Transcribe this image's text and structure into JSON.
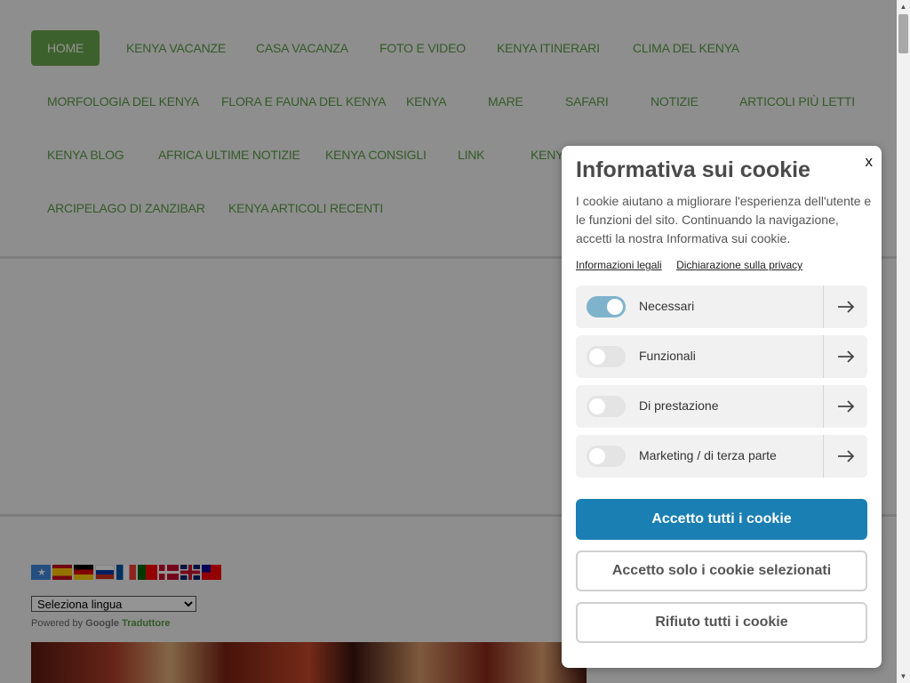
{
  "nav": {
    "items": [
      "HOME",
      "KENYA VACANZE",
      "CASA VACANZA",
      "FOTO E VIDEO",
      "KENYA ITINERARI",
      "CLIMA DEL KENYA",
      "MORFOLOGIA DEL KENYA",
      "FLORA E FAUNA DEL KENYA",
      "KENYA",
      "MARE",
      "SAFARI",
      "NOTIZIE",
      "ARTICOLI PIÙ LETTI",
      "KENYA BLOG",
      "AFRICA ULTIME NOTIZIE",
      "KENYA CONSIGLI",
      "LINK",
      "KENYA",
      "ARCIPELAGO DI ZANZIBAR",
      "KENYA ARTICOLI RECENTI"
    ]
  },
  "translate": {
    "select_label": "Seleziona lingua",
    "powered_by": "Powered by",
    "google": "Google",
    "translator": "Traduttore",
    "flag_icons": [
      "somalia-flag-icon",
      "spain-flag-icon",
      "germany-flag-icon",
      "russia-flag-icon",
      "france-flag-icon",
      "portugal-flag-icon",
      "denmark-flag-icon",
      "uk-flag-icon",
      "taiwan-flag-icon"
    ]
  },
  "cookie": {
    "close": "x",
    "title": "Informativa sui cookie",
    "description": "I cookie aiutano a migliorare l'esperienza dell'utente e le funzioni del sito. Continuando la navigazione, accetti la nostra Informativa sui cookie.",
    "link_legal": "Informazioni legali",
    "link_privacy": "Dichiarazione sulla privacy",
    "categories": [
      {
        "label": "Necessari",
        "enabled": true
      },
      {
        "label": "Funzionali",
        "enabled": false
      },
      {
        "label": "Di prestazione",
        "enabled": false
      },
      {
        "label": "Marketing / di terza parte",
        "enabled": false
      }
    ],
    "accept_all": "Accetto tutti i cookie",
    "accept_selected": "Accetto solo i cookie selezionati",
    "reject_all": "Rifiuto tutti i cookie"
  },
  "colors": {
    "nav_text": "#5b9b47",
    "nav_active_bg": "#6aa84f",
    "primary_button": "#1a7fb3",
    "toggle_on": "#7fb3cc"
  }
}
